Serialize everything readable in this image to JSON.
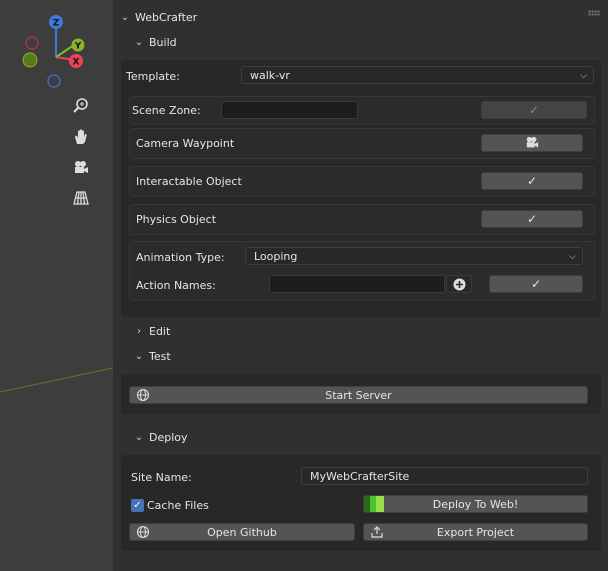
{
  "panel": {
    "title": "WebCrafter",
    "build": {
      "title": "Build",
      "template_label": "Template:",
      "template_value": "walk-vr",
      "scene_zone_label": "Scene Zone:",
      "scene_zone_value": "",
      "camera_waypoint_label": "Camera Waypoint",
      "interactable_label": "Interactable Object",
      "physics_label": "Physics Object",
      "animation_type_label": "Animation Type:",
      "animation_type_value": "Looping",
      "action_names_label": "Action Names:",
      "action_names_value": ""
    },
    "edit": {
      "title": "Edit"
    },
    "test": {
      "title": "Test",
      "start_server_label": "Start Server"
    },
    "deploy": {
      "title": "Deploy",
      "site_name_label": "Site Name:",
      "site_name_value": "MyWebCrafterSite",
      "cache_files_label": "Cache Files",
      "cache_files_checked": true,
      "deploy_label": "Deploy To Web!",
      "open_github_label": "Open Github",
      "export_project_label": "Export Project"
    }
  },
  "gizmo": {
    "x_label": "X",
    "y_label": "Y",
    "z_label": "Z"
  },
  "icons": [
    "zoom-icon",
    "hand-icon",
    "camera-icon",
    "grid-icon",
    "globe-icon",
    "upload-icon",
    "plus-icon",
    "check-icon"
  ],
  "colors": {
    "x_axis": "#e8455a",
    "y_axis": "#8ab32b",
    "z_axis": "#3d7bd8",
    "accent_blue": "#4772b3",
    "deploy_progress": "#4ec22a"
  }
}
